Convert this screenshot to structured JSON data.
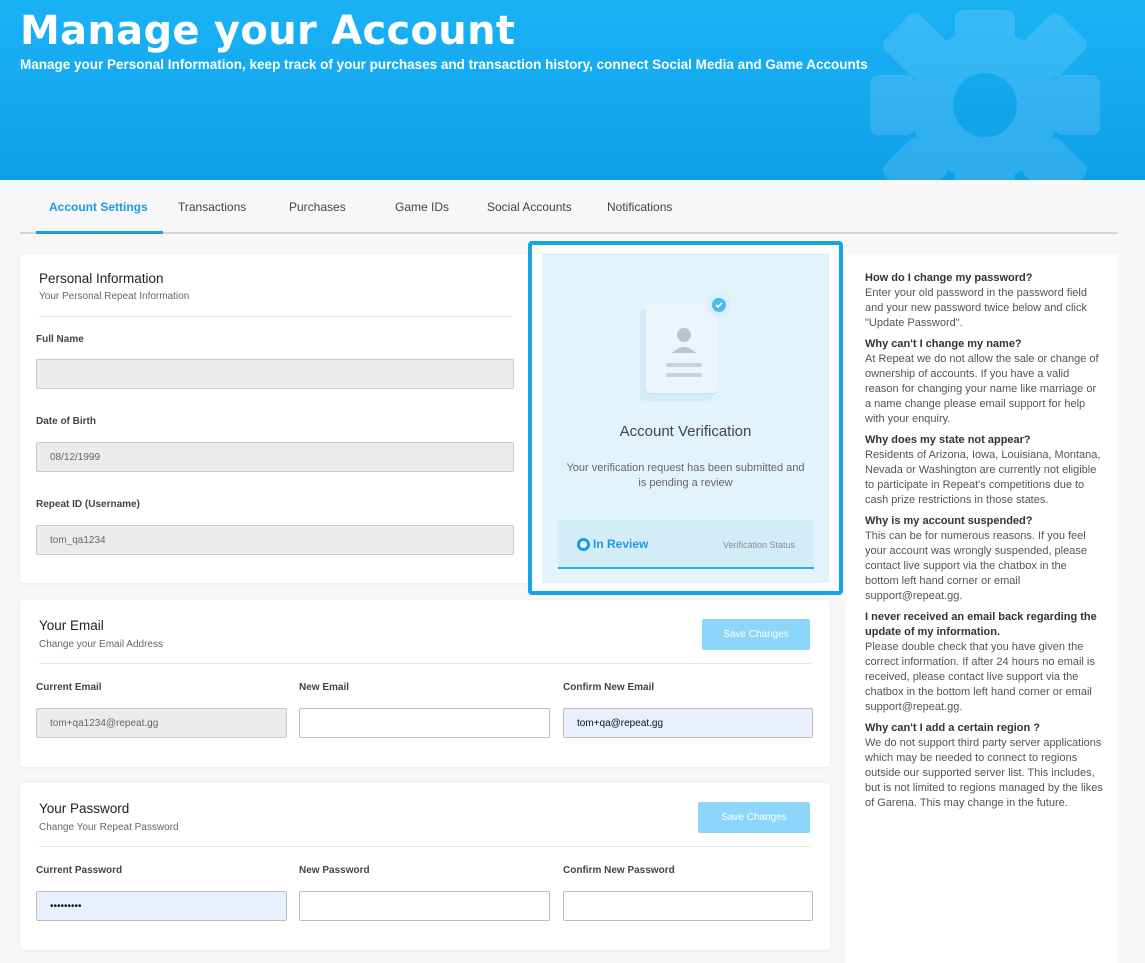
{
  "header": {
    "title": "Manage your Account",
    "subtitle": "Manage your Personal Information, keep track of your purchases and transaction history, connect Social Media and Game Accounts"
  },
  "tabs": [
    {
      "label": "Account Settings",
      "active": true
    },
    {
      "label": "Transactions",
      "active": false
    },
    {
      "label": "Purchases",
      "active": false
    },
    {
      "label": "Game IDs",
      "active": false
    },
    {
      "label": "Social Accounts",
      "active": false
    },
    {
      "label": "Notifications",
      "active": false
    }
  ],
  "personal": {
    "title": "Personal Information",
    "subtitle": "Your Personal Repeat Information",
    "full_name_label": "Full Name",
    "full_name_value": "",
    "dob_label": "Date of Birth",
    "dob_value": "08/12/1999",
    "repeat_id_label": "Repeat ID (Username)",
    "repeat_id_value": "tom_qa1234"
  },
  "verification": {
    "title": "Account Verification",
    "description": "Your verification request has been submitted and is pending a review",
    "status": "In Review",
    "status_label": "Verification Status"
  },
  "email": {
    "title": "Your Email",
    "subtitle": "Change your Email Address",
    "save_label": "Save Changes",
    "current_label": "Current Email",
    "current_value": "tom+qa1234@repeat.gg",
    "new_label": "New Email",
    "new_value": "",
    "confirm_label": "Confirm New Email",
    "confirm_value": "tom+qa@repeat.gg"
  },
  "password": {
    "title": "Your Password",
    "subtitle": "Change Your Repeat Password",
    "save_label": "Save Changes",
    "current_label": "Current Password",
    "current_value": "•••••••••",
    "new_label": "New Password",
    "new_value": "",
    "confirm_label": "Confirm New Password",
    "confirm_value": ""
  },
  "faq": [
    {
      "q": "How do I change my password?",
      "a": "Enter your old password in the password field and your new password twice below and click \"Update Password\"."
    },
    {
      "q": "Why can't I change my name?",
      "a": "At Repeat we do not allow the sale or change of ownership of accounts. If you have a valid reason for changing your name like marriage or a name change please email support for help with your enquiry."
    },
    {
      "q": "Why does my state not appear?",
      "a": "Residents of Arizona, Iowa, Louisiana, Montana, Nevada or Washington are currently not eligible to participate in Repeat's competitions due to cash prize restrictions in those states."
    },
    {
      "q": "Why is my account suspended?",
      "a": "This can be for numerous reasons. If you feel your account was wrongly suspended, please contact live support via the chatbox in the bottom left hand corner or email support@repeat.gg."
    },
    {
      "q": "I never received an email back regarding the update of my information.",
      "a": "Please double check that you have given the correct information. If after 24 hours no email is received, please contact live support via the chatbox in the bottom left hand corner or email support@repeat.gg."
    },
    {
      "q": "Why can't I add a certain region ?",
      "a": "We do not support third party server applications which may be needed to connect to regions outside our supported server list. This includes, but is not limited to regions managed by the likes of Garena. This may change in the future."
    }
  ],
  "colors": {
    "banner": "#14a8f0",
    "accent": "#1a9be6",
    "save_button": "#8dd6fb",
    "verification_bg": "#e1f4fc"
  }
}
